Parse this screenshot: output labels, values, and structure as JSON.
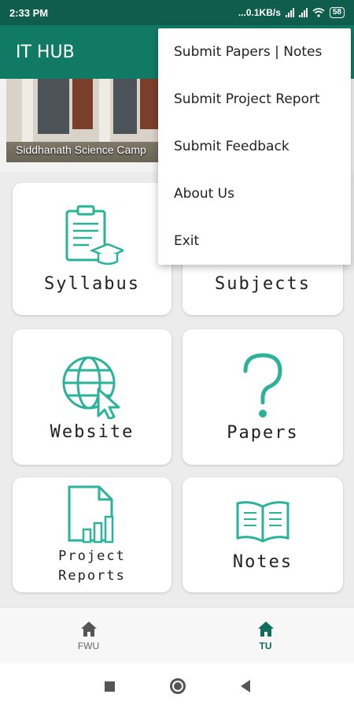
{
  "status_bar": {
    "time": "2:33 PM",
    "network": "...0.1KB/s",
    "battery": "58"
  },
  "app_bar": {
    "title": "IT HUB"
  },
  "banner": {
    "caption": "Siddhanath Science Camp"
  },
  "cards": [
    {
      "label": "Syllabus",
      "icon": "syllabus-clipboard-icon"
    },
    {
      "label": "Subjects",
      "icon": "subjects-icon"
    },
    {
      "label": "Website",
      "icon": "globe-cursor-icon"
    },
    {
      "label": "Papers",
      "icon": "question-mark-icon"
    },
    {
      "label_line1": "Project",
      "label_line2": "Reports",
      "icon": "report-chart-icon"
    },
    {
      "label": "Notes",
      "icon": "open-book-icon"
    }
  ],
  "bottom_nav": [
    {
      "label": "FWU",
      "icon": "home-icon",
      "active": false
    },
    {
      "label": "TU",
      "icon": "home-icon",
      "active": true
    }
  ],
  "overflow_menu": [
    {
      "label": "Submit Papers | Notes"
    },
    {
      "label": "Submit Project Report"
    },
    {
      "label": "Submit Feedback"
    },
    {
      "label": "About Us"
    },
    {
      "label": "Exit"
    }
  ],
  "colors": {
    "status_bar": "#0f5e4d",
    "app_bar": "#117a65",
    "icon_accent": "#2bb39a",
    "active_nav": "#0f6e5b"
  }
}
